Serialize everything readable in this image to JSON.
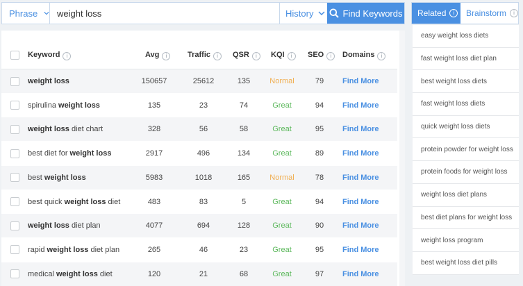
{
  "search": {
    "mode_label": "Phrase",
    "query": "weight loss",
    "history_label": "History",
    "find_label": "Find Keywords"
  },
  "table": {
    "headers": {
      "keyword": "Keyword",
      "avg": "Avg",
      "traffic": "Traffic",
      "qsr": "QSR",
      "kqi": "KQI",
      "seo": "SEO",
      "domains": "Domains"
    },
    "rows": [
      {
        "pre": "",
        "bold": "weight loss",
        "post": "",
        "avg": "150657",
        "traffic": "25612",
        "qsr": "135",
        "kqi": "Normal",
        "seo": "79",
        "domains": "Find More"
      },
      {
        "pre": "spirulina ",
        "bold": "weight loss",
        "post": "",
        "avg": "135",
        "traffic": "23",
        "qsr": "74",
        "kqi": "Great",
        "seo": "94",
        "domains": "Find More"
      },
      {
        "pre": "",
        "bold": "weight loss",
        "post": " diet chart",
        "avg": "328",
        "traffic": "56",
        "qsr": "58",
        "kqi": "Great",
        "seo": "95",
        "domains": "Find More"
      },
      {
        "pre": "best diet for ",
        "bold": "weight loss",
        "post": "",
        "avg": "2917",
        "traffic": "496",
        "qsr": "134",
        "kqi": "Great",
        "seo": "89",
        "domains": "Find More"
      },
      {
        "pre": "best ",
        "bold": "weight loss",
        "post": "",
        "avg": "5983",
        "traffic": "1018",
        "qsr": "165",
        "kqi": "Normal",
        "seo": "78",
        "domains": "Find More"
      },
      {
        "pre": "best quick ",
        "bold": "weight loss",
        "post": " diet",
        "avg": "483",
        "traffic": "83",
        "qsr": "5",
        "kqi": "Great",
        "seo": "94",
        "domains": "Find More"
      },
      {
        "pre": "",
        "bold": "weight loss",
        "post": " diet plan",
        "avg": "4077",
        "traffic": "694",
        "qsr": "128",
        "kqi": "Great",
        "seo": "90",
        "domains": "Find More"
      },
      {
        "pre": "rapid ",
        "bold": "weight loss",
        "post": " diet plan",
        "avg": "265",
        "traffic": "46",
        "qsr": "23",
        "kqi": "Great",
        "seo": "95",
        "domains": "Find More"
      },
      {
        "pre": "medical ",
        "bold": "weight loss",
        "post": " diet",
        "avg": "120",
        "traffic": "21",
        "qsr": "68",
        "kqi": "Great",
        "seo": "97",
        "domains": "Find More"
      }
    ]
  },
  "sidebar": {
    "tab_related": "Related",
    "tab_brainstorm": "Brainstorm",
    "items": [
      "easy weight loss diets",
      "fast weight loss diet plan",
      "best weight loss diets",
      "fast weight loss diets",
      "quick weight loss diets",
      "protein powder for weight loss",
      "protein foods for weight loss",
      "weight loss diet plans",
      "best diet plans for weight loss",
      "weight loss program",
      "best weight loss diet pills"
    ]
  },
  "icons": {
    "info": "i",
    "chevron": "chevron-down-icon",
    "search": "magnifier-icon"
  },
  "colors": {
    "accent": "#4a90e2",
    "great": "#5cb85c",
    "normal": "#f0ad4e"
  }
}
